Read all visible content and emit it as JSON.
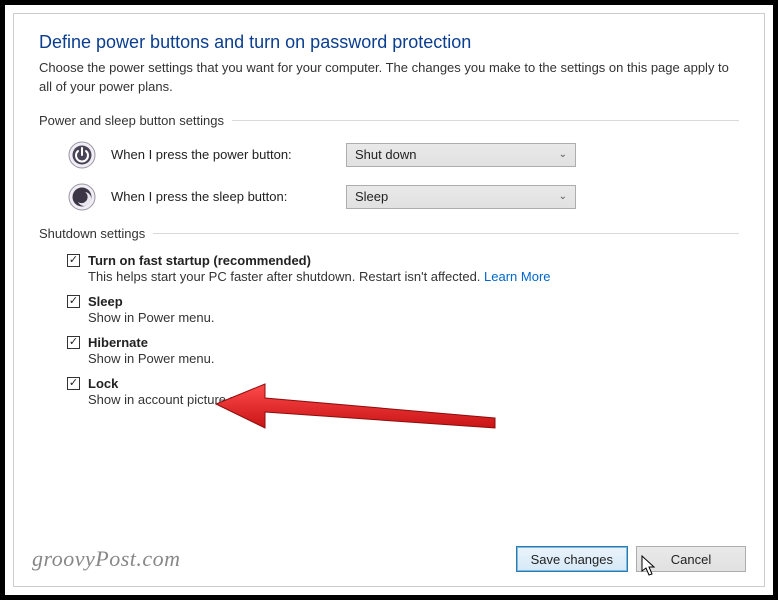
{
  "title": "Define power buttons and turn on password protection",
  "intro": "Choose the power settings that you want for your computer. The changes you make to the settings on this page apply to all of your power plans.",
  "section_buttons": "Power and sleep button settings",
  "power_row": {
    "label": "When I press the power button:",
    "value": "Shut down"
  },
  "sleep_row": {
    "label": "When I press the sleep button:",
    "value": "Sleep"
  },
  "section_shutdown": "Shutdown settings",
  "items": [
    {
      "title": "Turn on fast startup (recommended)",
      "desc": "This helps start your PC faster after shutdown. Restart isn't affected. ",
      "link": "Learn More",
      "checked": true
    },
    {
      "title": "Sleep",
      "desc": "Show in Power menu.",
      "link": "",
      "checked": true
    },
    {
      "title": "Hibernate",
      "desc": "Show in Power menu.",
      "link": "",
      "checked": true
    },
    {
      "title": "Lock",
      "desc": "Show in account picture menu.",
      "link": "",
      "checked": true
    }
  ],
  "actions": {
    "save": "Save changes",
    "cancel": "Cancel"
  },
  "watermark": "groovyPost.com"
}
